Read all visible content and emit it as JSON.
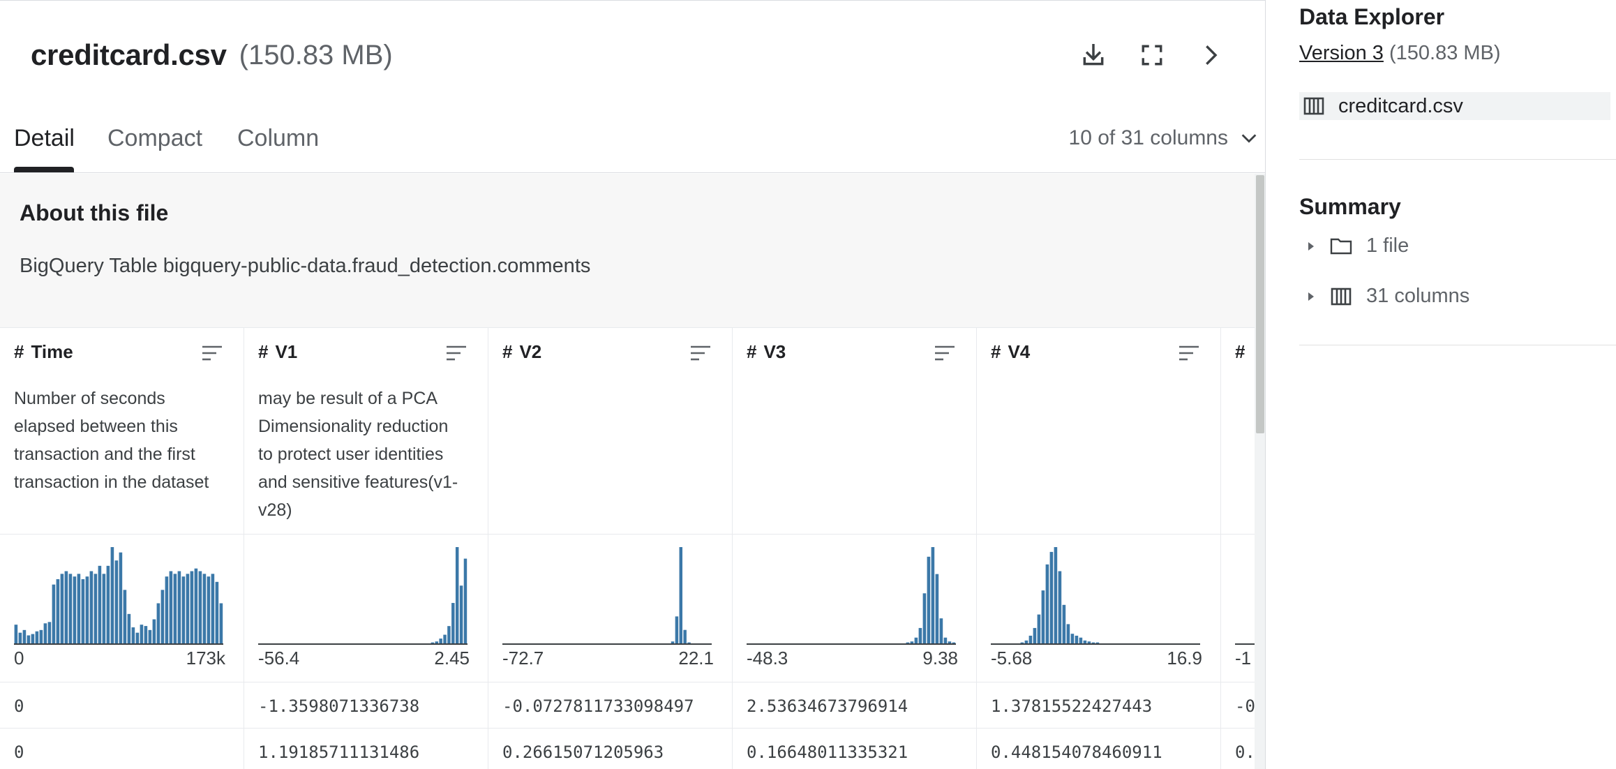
{
  "file": {
    "name": "creditcard.csv",
    "size": "(150.83 MB)"
  },
  "tabs": [
    {
      "label": "Detail",
      "active": true
    },
    {
      "label": "Compact",
      "active": false
    },
    {
      "label": "Column",
      "active": false
    }
  ],
  "column_selector": {
    "label": "10 of 31 columns"
  },
  "about": {
    "title": "About this file",
    "text": "BigQuery Table bigquery-public-data.fraud_detection.comments"
  },
  "columns": [
    {
      "type_icon": "#",
      "name": "Time",
      "description": "Number of seconds elapsed between this transaction and the first transaction in the dataset",
      "min": "0",
      "max": "173k",
      "histogram": [
        14,
        8,
        10,
        6,
        7,
        9,
        10,
        15,
        16,
        44,
        48,
        52,
        54,
        52,
        50,
        52,
        48,
        50,
        54,
        52,
        58,
        52,
        58,
        72,
        62,
        68,
        40,
        22,
        12,
        8,
        14,
        13,
        10,
        18,
        30,
        40,
        50,
        54,
        52,
        54,
        50,
        52,
        54,
        56,
        54,
        52,
        50,
        52,
        46,
        30
      ],
      "cells": [
        "0",
        "0"
      ]
    },
    {
      "type_icon": "#",
      "name": "V1",
      "description": "may be result of a PCA Dimensionality reduction to protect user identities and sensitive features(v1-v28)",
      "min": "-56.4",
      "max": "2.45",
      "histogram": [
        0,
        0,
        0,
        0,
        0,
        0,
        0,
        0,
        0,
        0,
        0,
        0,
        0,
        0,
        0,
        0,
        0,
        0,
        0,
        0,
        0,
        0,
        0,
        0,
        0,
        0,
        0,
        0,
        0,
        0,
        0,
        0,
        0,
        0,
        0,
        0,
        0,
        0,
        0,
        0,
        0,
        0,
        1,
        2,
        5,
        9,
        18,
        42,
        100,
        60,
        88
      ],
      "cells": [
        "-1.3598071336738",
        "1.19185711131486"
      ]
    },
    {
      "type_icon": "#",
      "name": "V2",
      "description": "",
      "min": "-72.7",
      "max": "22.1",
      "histogram": [
        0,
        0,
        0,
        0,
        0,
        0,
        0,
        0,
        0,
        0,
        0,
        0,
        0,
        0,
        0,
        0,
        0,
        0,
        0,
        0,
        0,
        0,
        0,
        0,
        0,
        0,
        0,
        0,
        0,
        0,
        0,
        0,
        0,
        0,
        0,
        0,
        0,
        0,
        0,
        0,
        0,
        2,
        28,
        100,
        14,
        1,
        0,
        0,
        0,
        0,
        0
      ],
      "cells": [
        "-0.0727811733098497",
        "0.26615071205963"
      ]
    },
    {
      "type_icon": "#",
      "name": "V3",
      "description": "",
      "min": "-48.3",
      "max": "9.38",
      "histogram": [
        0,
        0,
        0,
        0,
        0,
        0,
        0,
        0,
        0,
        0,
        0,
        0,
        0,
        0,
        0,
        0,
        0,
        0,
        0,
        0,
        0,
        0,
        0,
        0,
        0,
        0,
        0,
        0,
        0,
        0,
        0,
        0,
        0,
        0,
        0,
        0,
        0,
        0,
        1,
        2,
        6,
        16,
        52,
        90,
        100,
        72,
        26,
        6,
        2,
        1
      ],
      "cells": [
        "2.53634673796914",
        "0.16648011335321"
      ]
    },
    {
      "type_icon": "#",
      "name": "V4",
      "description": "",
      "min": "-5.68",
      "max": "16.9",
      "histogram": [
        0,
        0,
        0,
        0,
        0,
        0,
        0,
        1,
        3,
        8,
        16,
        30,
        55,
        82,
        95,
        100,
        75,
        40,
        20,
        10,
        8,
        6,
        3,
        2,
        1,
        1,
        0,
        0,
        0,
        0,
        0,
        0,
        0,
        0,
        0,
        0,
        0,
        0,
        0,
        0,
        0,
        0,
        0,
        0,
        0,
        0,
        0,
        0,
        0,
        0
      ],
      "cells": [
        "1.37815522427443",
        "0.448154078460911"
      ]
    },
    {
      "type_icon": "#",
      "name": "",
      "description": "",
      "min": "-1",
      "max": "",
      "histogram": [
        0,
        0,
        0
      ],
      "cells": [
        "-0",
        "0."
      ]
    }
  ],
  "sidebar": {
    "title": "Data Explorer",
    "version_link": "Version 3",
    "version_size": "(150.83 MB)",
    "file": "creditcard.csv",
    "summary_title": "Summary",
    "summary_items": [
      {
        "icon": "folder-icon",
        "label": "1 file"
      },
      {
        "icon": "columns-icon",
        "label": "31 columns"
      }
    ]
  },
  "colors": {
    "histogram_bar": "#3b78a8",
    "accent": "#202124"
  }
}
